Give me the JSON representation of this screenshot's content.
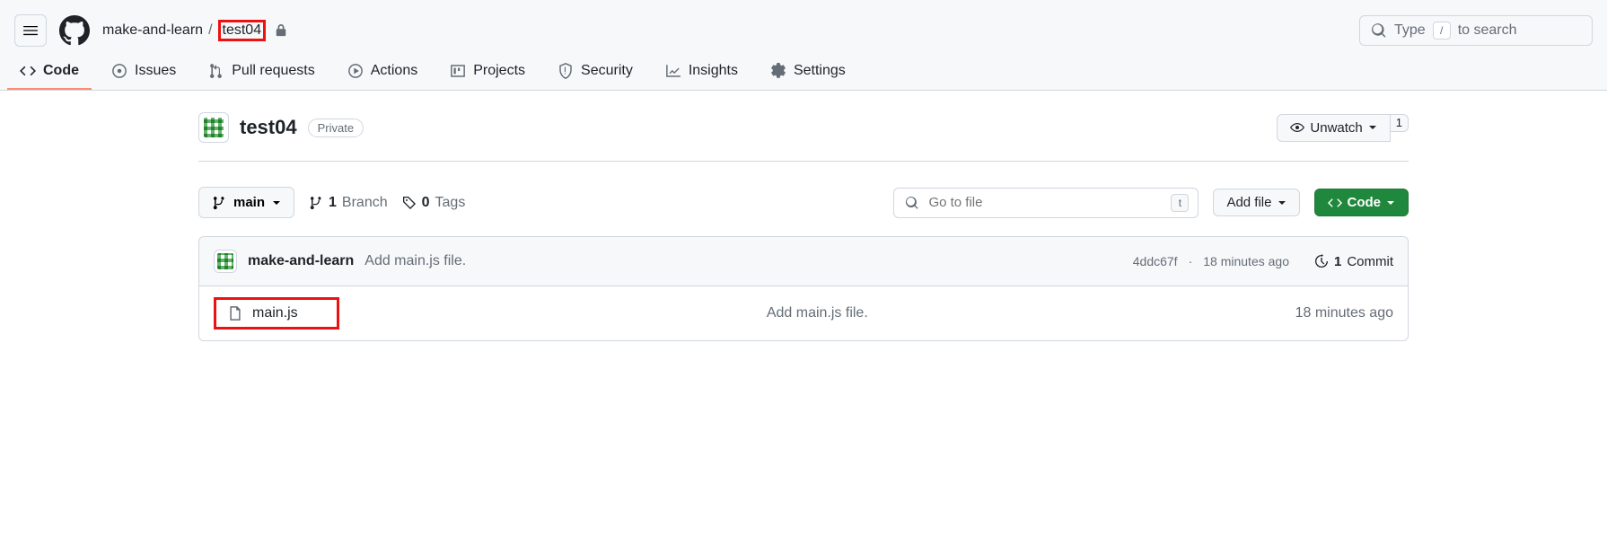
{
  "breadcrumb": {
    "owner": "make-and-learn",
    "sep": "/",
    "repo": "test04"
  },
  "search": {
    "placeholder_prefix": "Type",
    "kbd": "/",
    "placeholder_suffix": "to search"
  },
  "tabs": {
    "code": "Code",
    "issues": "Issues",
    "pulls": "Pull requests",
    "actions": "Actions",
    "projects": "Projects",
    "security": "Security",
    "insights": "Insights",
    "settings": "Settings"
  },
  "repo": {
    "name": "test04",
    "visibility": "Private"
  },
  "unwatch": {
    "label": "Unwatch",
    "count": "1"
  },
  "branch": {
    "name": "main"
  },
  "branches": {
    "count": "1",
    "label": "Branch"
  },
  "tags": {
    "count": "0",
    "label": "Tags"
  },
  "gotofile": {
    "placeholder": "Go to file",
    "kbd": "t"
  },
  "addfile": {
    "label": "Add file"
  },
  "codebtn": {
    "label": "Code"
  },
  "commit": {
    "author": "make-and-learn",
    "message": "Add main.js file.",
    "sha": "4ddc67f",
    "dot": "·",
    "time": "18 minutes ago",
    "count": "1",
    "count_label": "Commit"
  },
  "file": {
    "name": "main.js",
    "message": "Add main.js file.",
    "time": "18 minutes ago"
  }
}
